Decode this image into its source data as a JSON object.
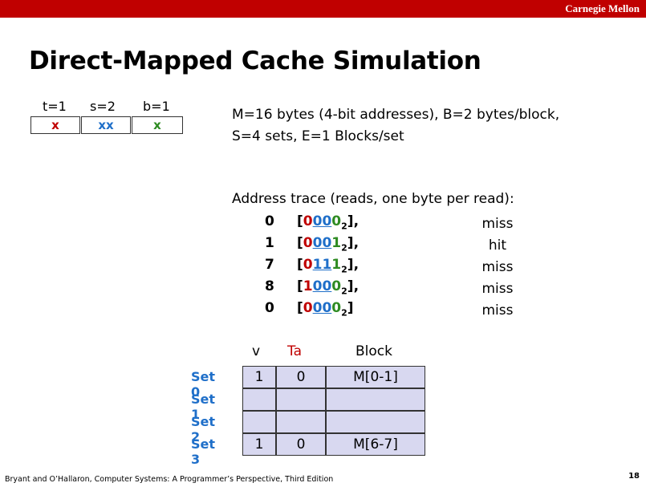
{
  "header": {
    "org": "Carnegie Mellon",
    "color": "#c00000"
  },
  "title": "Direct-Mapped Cache Simulation",
  "address_format": {
    "labels": [
      "t=1",
      "s=2",
      "b=1"
    ],
    "fields": [
      {
        "text": "x",
        "color": "#c00000"
      },
      {
        "text": "xx",
        "color": "#1f6fc9"
      },
      {
        "text": "x",
        "color": "#2e8b22"
      }
    ]
  },
  "params": {
    "line1": "M=16 bytes (4-bit addresses), B=2 bytes/block,",
    "line2": "S=4 sets, E=1 Blocks/set"
  },
  "trace": {
    "heading": "Address trace (reads, one byte per read):",
    "rows": [
      {
        "addr": "0",
        "tag": "0",
        "set": "00",
        "off": "0",
        "close": "],",
        "result": "miss"
      },
      {
        "addr": "1",
        "tag": "0",
        "set": "00",
        "off": "1",
        "close": "],",
        "result": "hit"
      },
      {
        "addr": "7",
        "tag": "0",
        "set": "11",
        "off": "1",
        "close": "],",
        "result": "miss"
      },
      {
        "addr": "8",
        "tag": "1",
        "set": "00",
        "off": "0",
        "close": "],",
        "result": "miss"
      },
      {
        "addr": "0",
        "tag": "0",
        "set": "00",
        "off": "0",
        "close": "]",
        "result": "miss"
      }
    ],
    "subscript": "2"
  },
  "cache": {
    "headers": {
      "v": "v",
      "tag": "Ta",
      "block": "Block"
    },
    "sets": [
      {
        "label": "Set 0",
        "v": "1",
        "tag": "0",
        "block": "M[0-1]"
      },
      {
        "label": "Set 1",
        "v": "",
        "tag": "",
        "block": ""
      },
      {
        "label": "Set 2",
        "v": "",
        "tag": "",
        "block": ""
      },
      {
        "label": "Set 3",
        "v": "1",
        "tag": "0",
        "block": "M[6-7]"
      }
    ]
  },
  "footer": {
    "citation": "Bryant and O’Hallaron, Computer Systems: A Programmer’s Perspective, Third Edition",
    "page": "18"
  }
}
